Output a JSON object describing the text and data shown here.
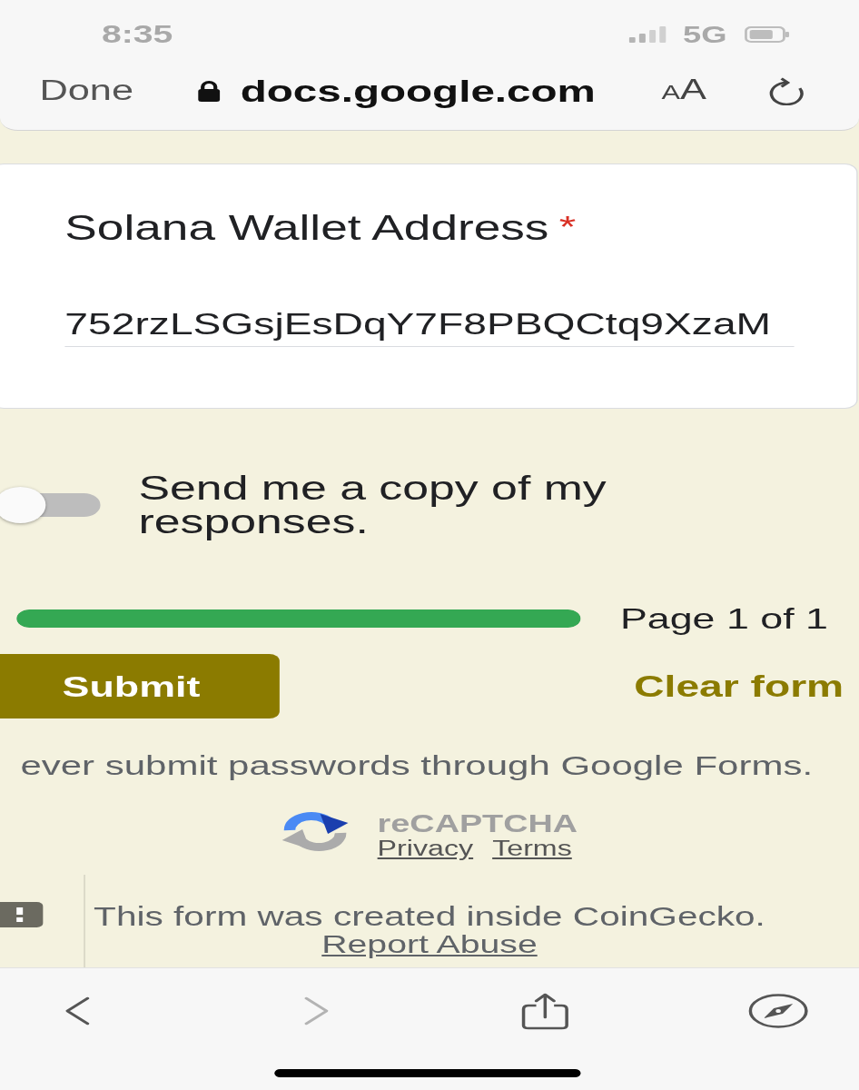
{
  "status_bar": {
    "time": "8:35",
    "network": "5G"
  },
  "address_bar": {
    "done": "Done",
    "url": "docs.google.com",
    "text_size": "AA"
  },
  "question": {
    "title": "Solana Wallet Address",
    "required_mark": "*",
    "value": "752rzLSGsjEsDqY7F8PBQCtq9XzaM"
  },
  "send_copy": {
    "label": "Send me a copy of my responses.",
    "on": false
  },
  "progress": {
    "level": 1,
    "label": "Page 1 of 1"
  },
  "submit_button": "Submit",
  "clear_button": "Clear form",
  "notice": "ever submit passwords through Google Forms.",
  "recaptcha": {
    "title": "reCAPTCHA",
    "links": [
      "Privacy",
      "Terms"
    ]
  },
  "footer": {
    "text": "This form was created inside CoinGecko.",
    "link": "Report Abuse"
  },
  "toolbar": [
    {
      "kind": "back",
      "disabled": false
    },
    {
      "kind": "forward",
      "disabled": true
    },
    {
      "kind": "share",
      "disabled": false
    },
    {
      "kind": "compass",
      "disabled": false
    }
  ]
}
